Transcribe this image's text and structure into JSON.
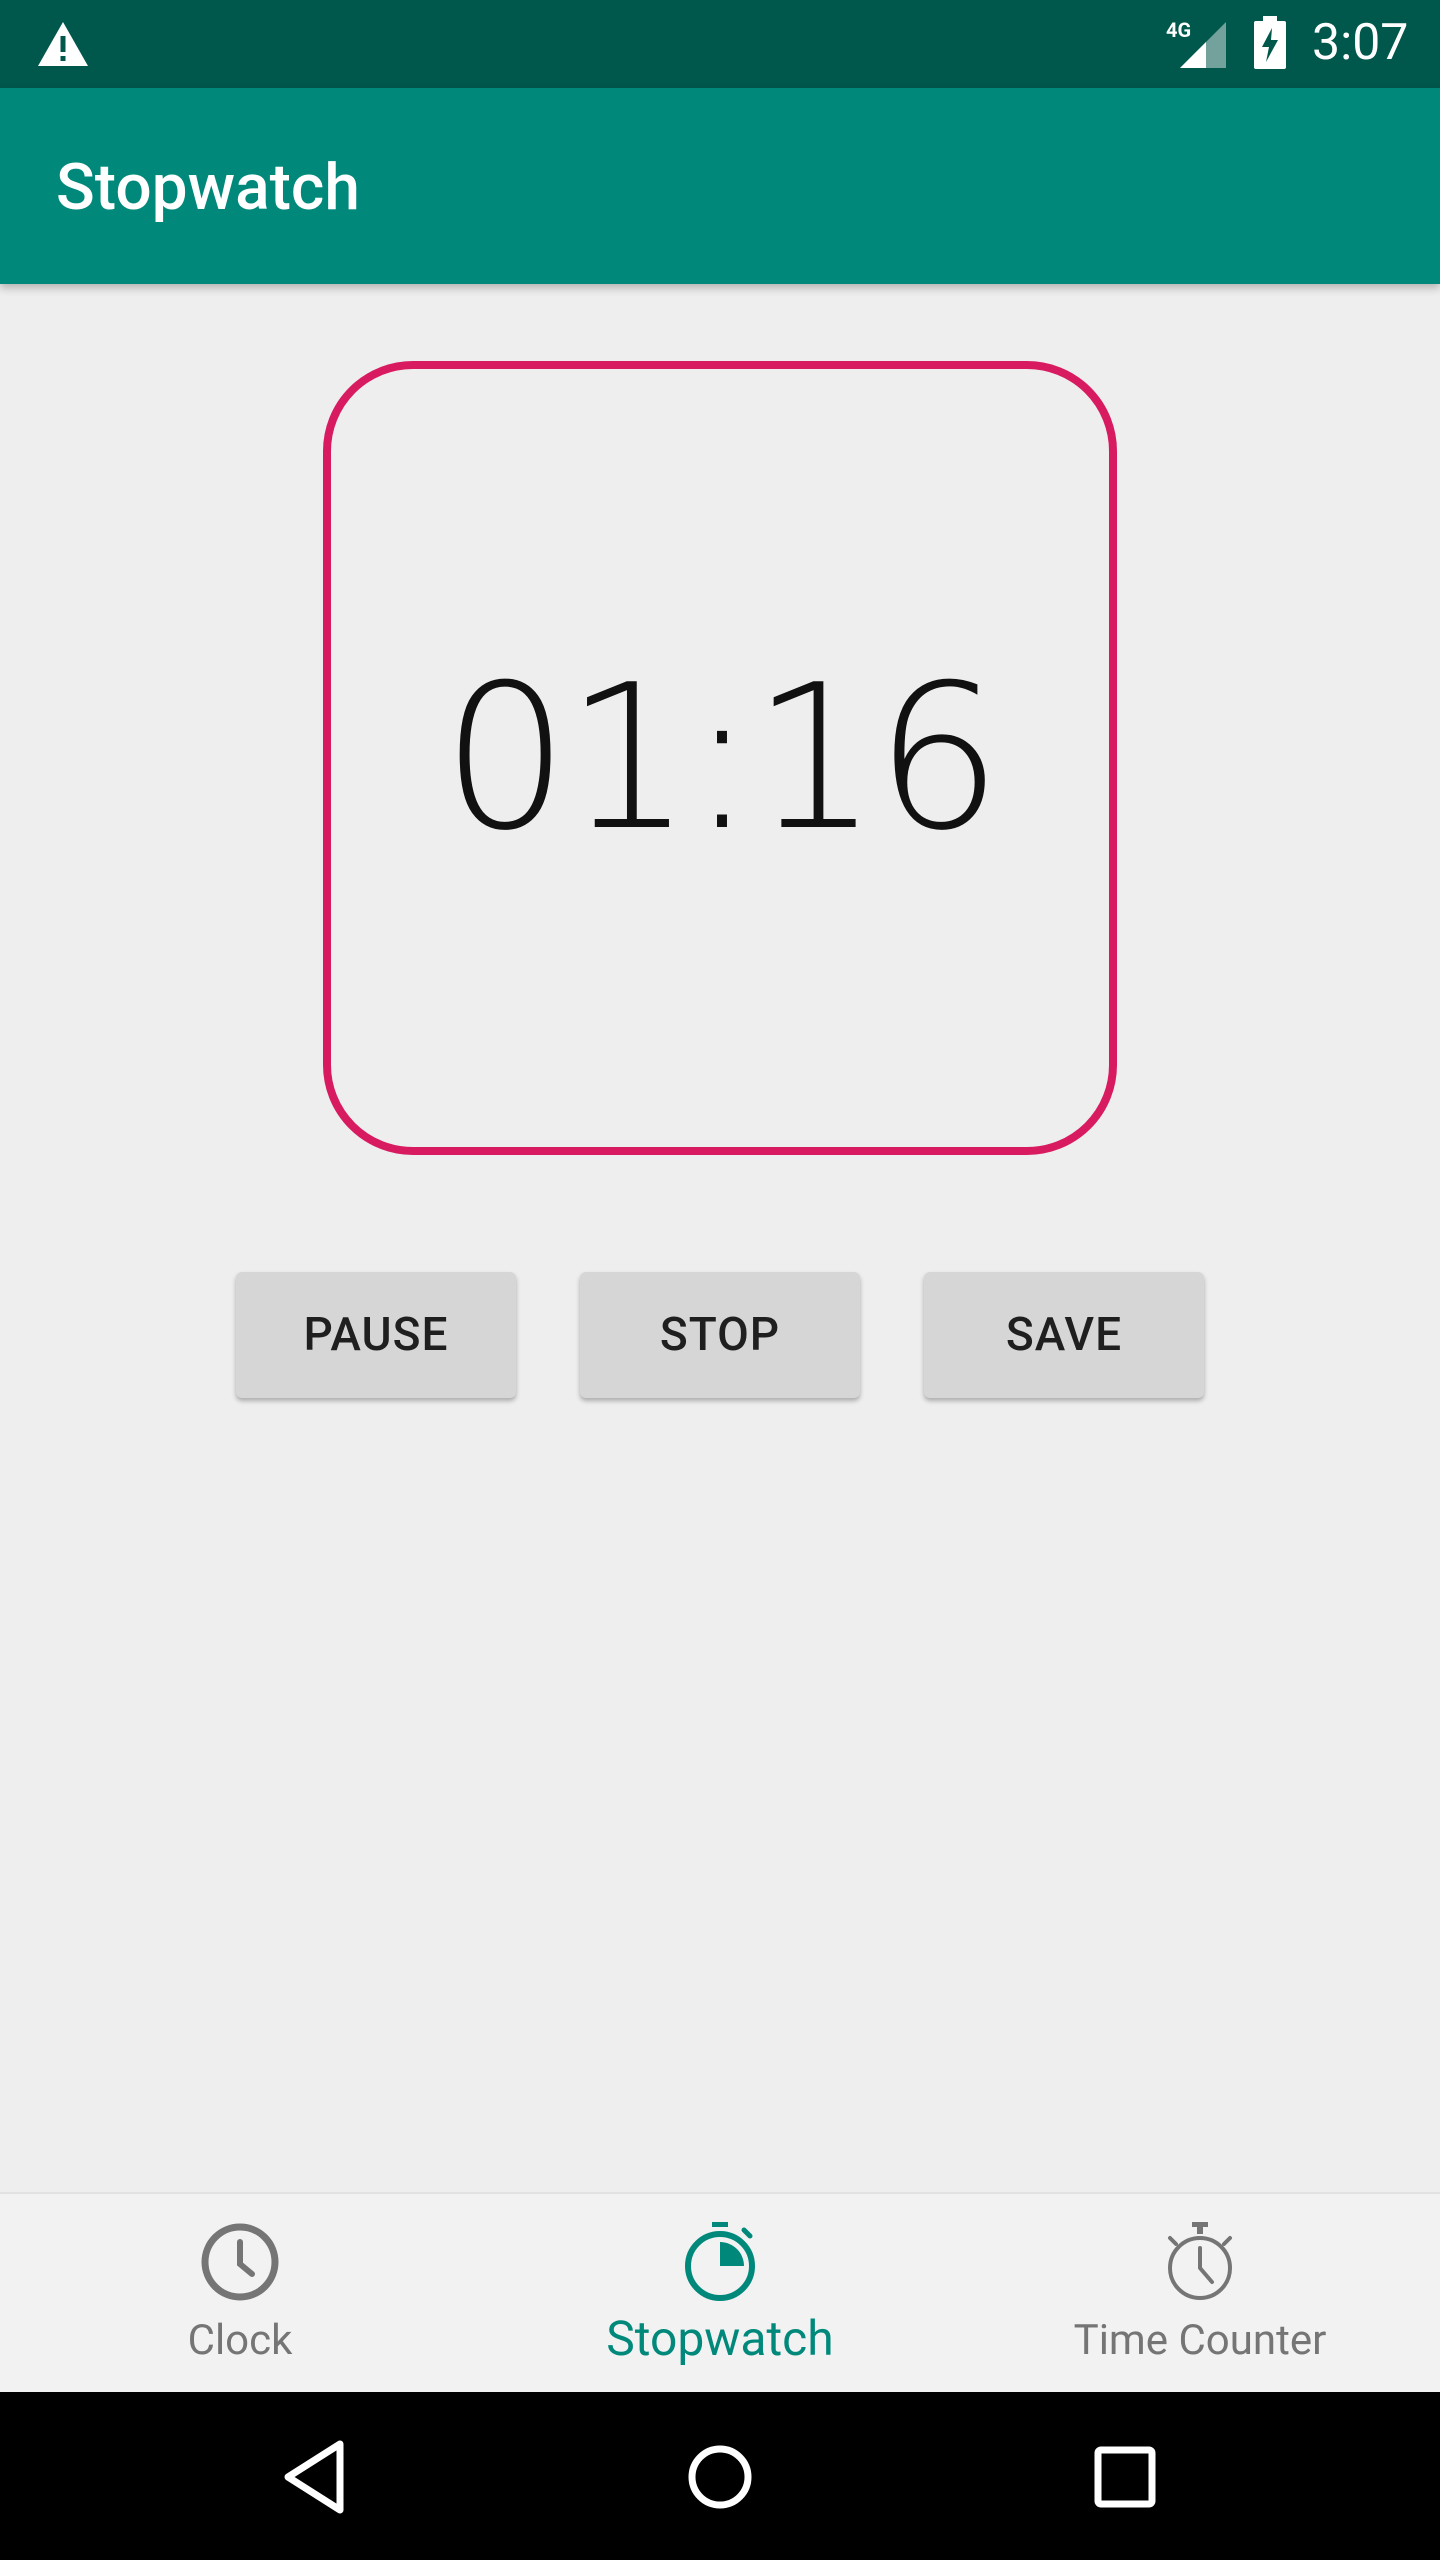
{
  "status_bar": {
    "time": "3:07",
    "network": "4G",
    "icons": [
      "warning-icon",
      "signal-icon",
      "battery-charging-icon"
    ]
  },
  "app_bar": {
    "title": "Stopwatch"
  },
  "timer": {
    "display": "01:16",
    "frame_color": "#d81b60"
  },
  "actions": {
    "pause_label": "PAUSE",
    "stop_label": "STOP",
    "save_label": "SAVE"
  },
  "bottom_nav": {
    "selected": "Stopwatch",
    "accent_color": "#00897b",
    "items": [
      {
        "label": "Clock",
        "icon": "clock-icon"
      },
      {
        "label": "Stopwatch",
        "icon": "stopwatch-icon"
      },
      {
        "label": "Time Counter",
        "icon": "timer-icon"
      }
    ]
  },
  "system_nav": {
    "buttons": [
      "back-icon",
      "home-icon",
      "recents-icon"
    ]
  }
}
